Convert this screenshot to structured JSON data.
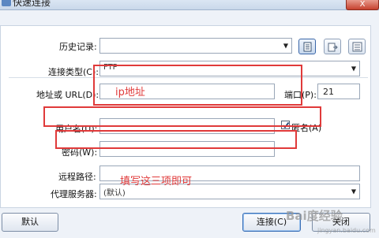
{
  "window": {
    "title": "快速连接",
    "close_label": "X"
  },
  "history": {
    "label": "历史记录:",
    "value": ""
  },
  "toolbar": {
    "icons": [
      "document-icon",
      "import-icon",
      "export-icon"
    ]
  },
  "connection_type": {
    "label": "连接类型(C):",
    "value": "FTP"
  },
  "address": {
    "label": "地址或 URL(D):",
    "value": "",
    "annotation": "ip地址"
  },
  "port": {
    "label": "端口(P):",
    "value": "21"
  },
  "username": {
    "label": "用户名(U):",
    "value": ""
  },
  "anonymous": {
    "label": "匿名(A)",
    "checked": true
  },
  "password": {
    "label": "密码(W):",
    "value": ""
  },
  "remote_path": {
    "label": "远程路径:",
    "value": ""
  },
  "proxy": {
    "label": "代理服务器:",
    "value": "(默认)"
  },
  "note": "填写这三项即可",
  "buttons": {
    "default": "默认",
    "connect": "连接(C)",
    "close": "关闭"
  },
  "watermark": {
    "text": "Bai度经验",
    "sub": "jingyan.baidu.com"
  },
  "colors": {
    "annotation": "#e03a3a",
    "accent": "#3a6fb6"
  }
}
